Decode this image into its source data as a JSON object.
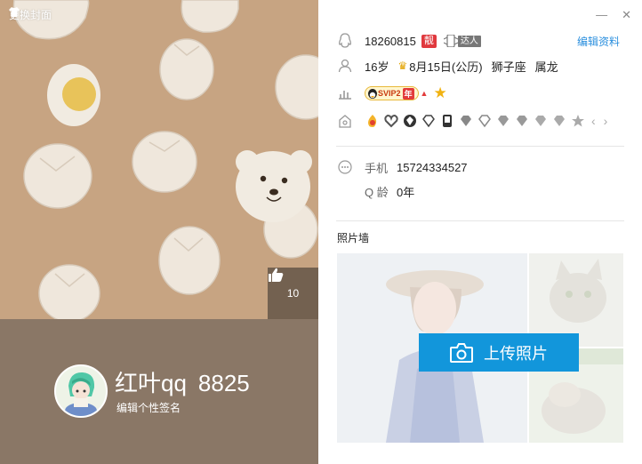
{
  "cover": {
    "change_cover_label": "更换封面",
    "like_count": "10"
  },
  "profile": {
    "nickname": "红叶qq",
    "number_partial": "8825",
    "signature_placeholder": "编辑个性签名"
  },
  "info": {
    "qq_number": "18260815",
    "beauty_badge": "靓",
    "talent_tag": "达人",
    "edit_profile": "编辑资料",
    "age": "16岁",
    "birthday": "8月15日(公历)",
    "zodiac": "狮子座",
    "chinese_zodiac": "属龙",
    "svip_label": "SVIP2",
    "svip_year": "年",
    "phone_label": "手机",
    "phone_value": "15724334527",
    "qage_label": "Q 龄",
    "qage_value": "0年"
  },
  "photos": {
    "title": "照片墙",
    "upload_label": "上传照片"
  },
  "colors": {
    "cover_bg": "#c7a482",
    "strip_bg": "#8a7766",
    "accent": "#1296db",
    "link": "#2b8fde"
  }
}
